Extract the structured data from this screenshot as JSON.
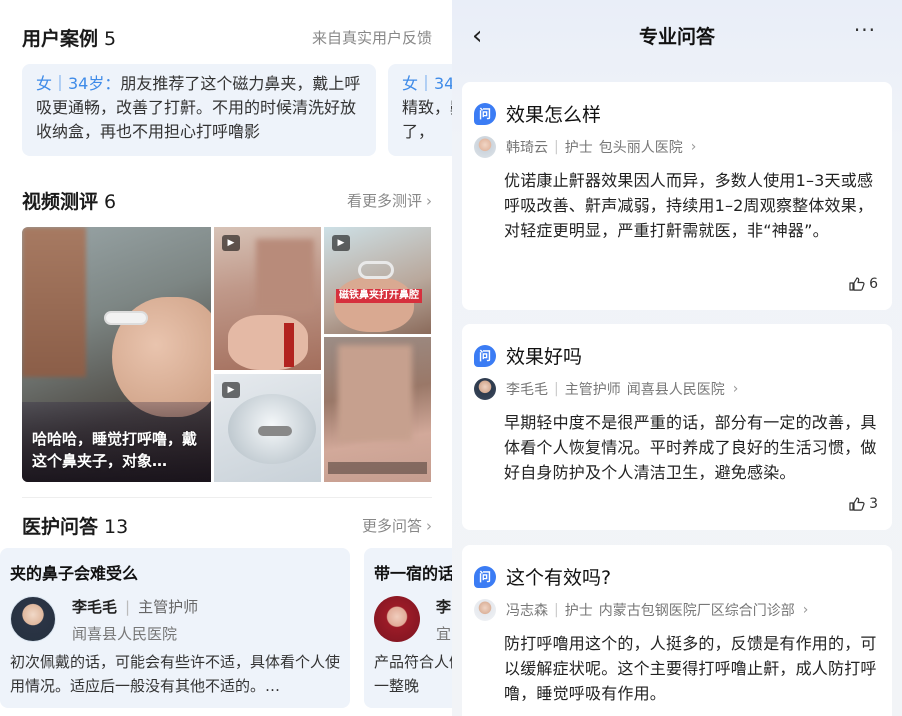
{
  "left": {
    "cases": {
      "title": "用户案例",
      "count": "5",
      "source": "来自真实用户反馈",
      "cards": [
        {
          "tag": "女｜34岁：",
          "text": "朋友推荐了这个磁力鼻夹，戴上呼吸更通畅，改善了打鼾。不用的时候清洗好放收纳盒，再也不用担心打呼噜影"
        },
        {
          "tag": "女｜34",
          "text": "精致，鼾了，"
        }
      ]
    },
    "videos": {
      "title": "视频测评",
      "count": "6",
      "more": "看更多测评",
      "main_caption": "哈哈哈，睡觉打呼噜，戴这个鼻夹子，对象…",
      "thumb_label": "磁铁鼻夹打开鼻腔"
    },
    "qa": {
      "title": "医护问答",
      "count": "13",
      "more": "更多问答",
      "cards": [
        {
          "question": "夹的鼻子会难受么",
          "doctor": "李毛毛",
          "role": "主管护师",
          "hospital": "闻喜县人民医院",
          "answer": "初次佩戴的话，可能会有些许不适，具体看个人使用情况。适应后一般没有其他不适的。…"
        },
        {
          "question": "带一宿的话",
          "doctor": "李",
          "role": "",
          "hospital": "宜",
          "answer": "产品符合人佩戴一整晚"
        }
      ]
    }
  },
  "right": {
    "nav": {
      "back": "‹",
      "title": "专业问答",
      "more": "···"
    },
    "items": [
      {
        "badge": "问",
        "question": "效果怎么样",
        "name": "韩琦云",
        "role": "护士",
        "hospital": "包头丽人医院",
        "answer": "优诺康止鼾器效果因人而异，多数人使用1–3天或感呼吸改善、鼾声减弱，持续用1–2周观察整体效果，对轻症更明显，严重打鼾需就医，非“神器”。",
        "likes": "6"
      },
      {
        "badge": "问",
        "question": "效果好吗",
        "name": "李毛毛",
        "role": "主管护师",
        "hospital": "闻喜县人民医院",
        "answer": "早期轻中度不是很严重的话，部分有一定的改善，具体看个人恢复情况。平时养成了良好的生活习惯，做好自身防护及个人清洁卫生，避免感染。",
        "likes": "3"
      },
      {
        "badge": "问",
        "question": "这个有效吗?",
        "name": "冯志森",
        "role": "护士",
        "hospital": "内蒙古包钢医院厂区综合门诊部",
        "answer": "防打呼噜用这个的，人挺多的，反馈是有作用的，可以缓解症状呢。这个主要得打呼噜止鼾，成人防打呼噜，睡觉呼吸有作用。",
        "likes": ""
      }
    ]
  }
}
